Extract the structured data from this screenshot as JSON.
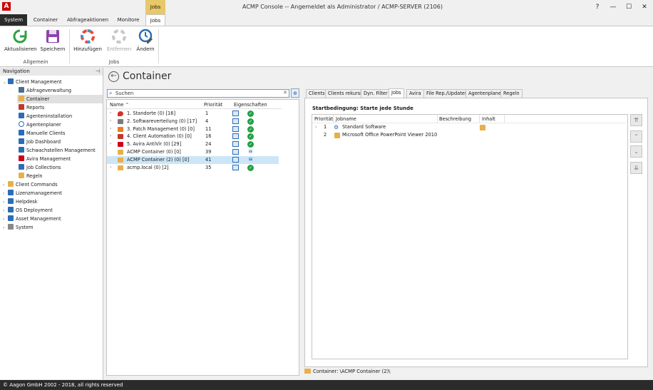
{
  "window": {
    "title": "ACMP Console -- Angemeldet als Administrator / ACMP-SERVER (2106)",
    "context_tab": "Jobs",
    "controls": [
      "?",
      "—",
      "☐",
      "✕"
    ]
  },
  "ribbon_tabs": [
    "System",
    "Container",
    "Abfrageaktionen",
    "Monitore",
    "Jobs"
  ],
  "ribbon": {
    "groups": [
      {
        "label": "Allgemein",
        "buttons": [
          {
            "label": "Aktualisieren"
          },
          {
            "label": "Speichern"
          }
        ]
      },
      {
        "label": "Jobs",
        "buttons": [
          {
            "label": "Hinzufügen"
          },
          {
            "label": "Entfernen",
            "disabled": true
          },
          {
            "label": "Ändern"
          }
        ]
      }
    ]
  },
  "navigation": {
    "header": "Navigation",
    "items": [
      {
        "label": "Client Management",
        "level": 0,
        "expanded": true
      },
      {
        "label": "Abfrageverwaltung",
        "level": 1
      },
      {
        "label": "Container",
        "level": 1,
        "selected": true
      },
      {
        "label": "Reports",
        "level": 1
      },
      {
        "label": "Agenteninstallation",
        "level": 1
      },
      {
        "label": "Agentenplaner",
        "level": 1
      },
      {
        "label": "Manuelle Clients",
        "level": 1
      },
      {
        "label": "Job Dashboard",
        "level": 1
      },
      {
        "label": "Schwachstellen Management",
        "level": 1
      },
      {
        "label": "Avira Management",
        "level": 1
      },
      {
        "label": "Job Collections",
        "level": 1
      },
      {
        "label": "Regeln",
        "level": 1
      },
      {
        "label": "Client Commands",
        "level": 0
      },
      {
        "label": "Lizenzmanagement",
        "level": 0
      },
      {
        "label": "Helpdesk",
        "level": 0
      },
      {
        "label": "OS Deployment",
        "level": 0
      },
      {
        "label": "Asset Management",
        "level": 0
      },
      {
        "label": "System",
        "level": 0
      }
    ]
  },
  "main": {
    "title": "Container",
    "search": {
      "placeholder": "Suchen"
    },
    "tree": {
      "columns": [
        "Name",
        "Priorität",
        "Eigenschaften"
      ],
      "rows": [
        {
          "name": "1. Standorte (0) [16]",
          "priority": "1",
          "icon": "pin-icon",
          "color": "#d93025",
          "expandable": true,
          "status": "ok"
        },
        {
          "name": "2. Softwareverteilung (0) [17]",
          "priority": "4",
          "icon": "software-icon",
          "color": "#7a7a7a",
          "expandable": true,
          "status": "ok"
        },
        {
          "name": "3. Patch Management (0) [0]",
          "priority": "11",
          "icon": "patch-icon",
          "color": "#e67e22",
          "expandable": true,
          "status": "ok"
        },
        {
          "name": "4. Client Automation (0) [0]",
          "priority": "16",
          "icon": "automation-icon",
          "color": "#c0392b",
          "expandable": true,
          "status": "ok"
        },
        {
          "name": "5. Avira AntiVir (0) [29]",
          "priority": "24",
          "icon": "avira-icon",
          "color": "#d0021b",
          "expandable": true,
          "status": "ok"
        },
        {
          "name": "ACMP Container (0) [0]",
          "priority": "39",
          "icon": "folder-icon",
          "color": "#e8b04a",
          "expandable": false,
          "status": "wifi"
        },
        {
          "name": "ACMP Container (2) (0) [0]",
          "priority": "41",
          "icon": "folder-icon",
          "color": "#e8b04a",
          "expandable": false,
          "status": "wifi",
          "selected": true
        },
        {
          "name": "acmp.local (0) [2]",
          "priority": "35",
          "icon": "folder-icon",
          "color": "#e8b04a",
          "expandable": true,
          "status": "ok"
        }
      ]
    }
  },
  "details": {
    "tabs": [
      "Clients",
      "Clients rekursiv",
      "Dyn. Filter",
      "Jobs",
      "Avira",
      "File Rep./Updates",
      "Agentenplaner",
      "Regeln"
    ],
    "active_tab": "Jobs",
    "start_condition": "Startbedingung: Starte jede Stunde",
    "grid_columns": [
      "Priorität",
      "Jobname",
      "Beschreibung",
      "Inhalt"
    ],
    "jobs": [
      {
        "priority": "1",
        "name": "Standard Software",
        "expandable": true,
        "icon": "gear-icon"
      },
      {
        "priority": "2",
        "name": "Microsoft Office PowerPoint Viewer 2010",
        "expandable": false,
        "icon": "puzzle-icon"
      }
    ],
    "side_buttons": [
      "move-top",
      "move-up",
      "move-down",
      "move-bottom"
    ]
  },
  "path": "Container: \\ACMP Container (2)\\",
  "status_bar": "© Aagon GmbH 2002 - 2018, all rights reserved"
}
